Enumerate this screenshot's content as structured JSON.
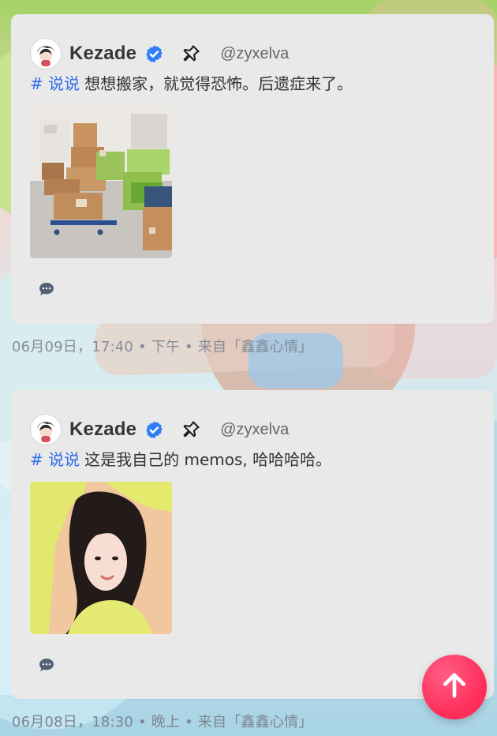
{
  "posts": [
    {
      "author": "Kezade",
      "handle": "@zyxelva",
      "tag": "# 说说",
      "text": "想想搬家，就觉得恐怖。后遗症来了。",
      "meta": "06月09日，17:40 • 下午 • 来自「鑫鑫心情」",
      "image": "moving-boxes-photo"
    },
    {
      "author": "Kezade",
      "handle": "@zyxelva",
      "tag": "# 说说",
      "text": "这是我自己的 memos, 哈哈哈哈。",
      "meta": "06月08日，18:30 • 晚上 • 来自「鑫鑫心情」",
      "image": "portrait-photo"
    }
  ],
  "icons": {
    "verified": "verified-badge-icon",
    "pin": "pin-icon",
    "comment": "comment-bubble-icon",
    "scroll_top": "arrow-up-icon"
  },
  "colors": {
    "card": "#e9e9e9",
    "tag": "#2d6ee8",
    "verified": "#2f7ef6",
    "fab": "#ff2f59"
  }
}
